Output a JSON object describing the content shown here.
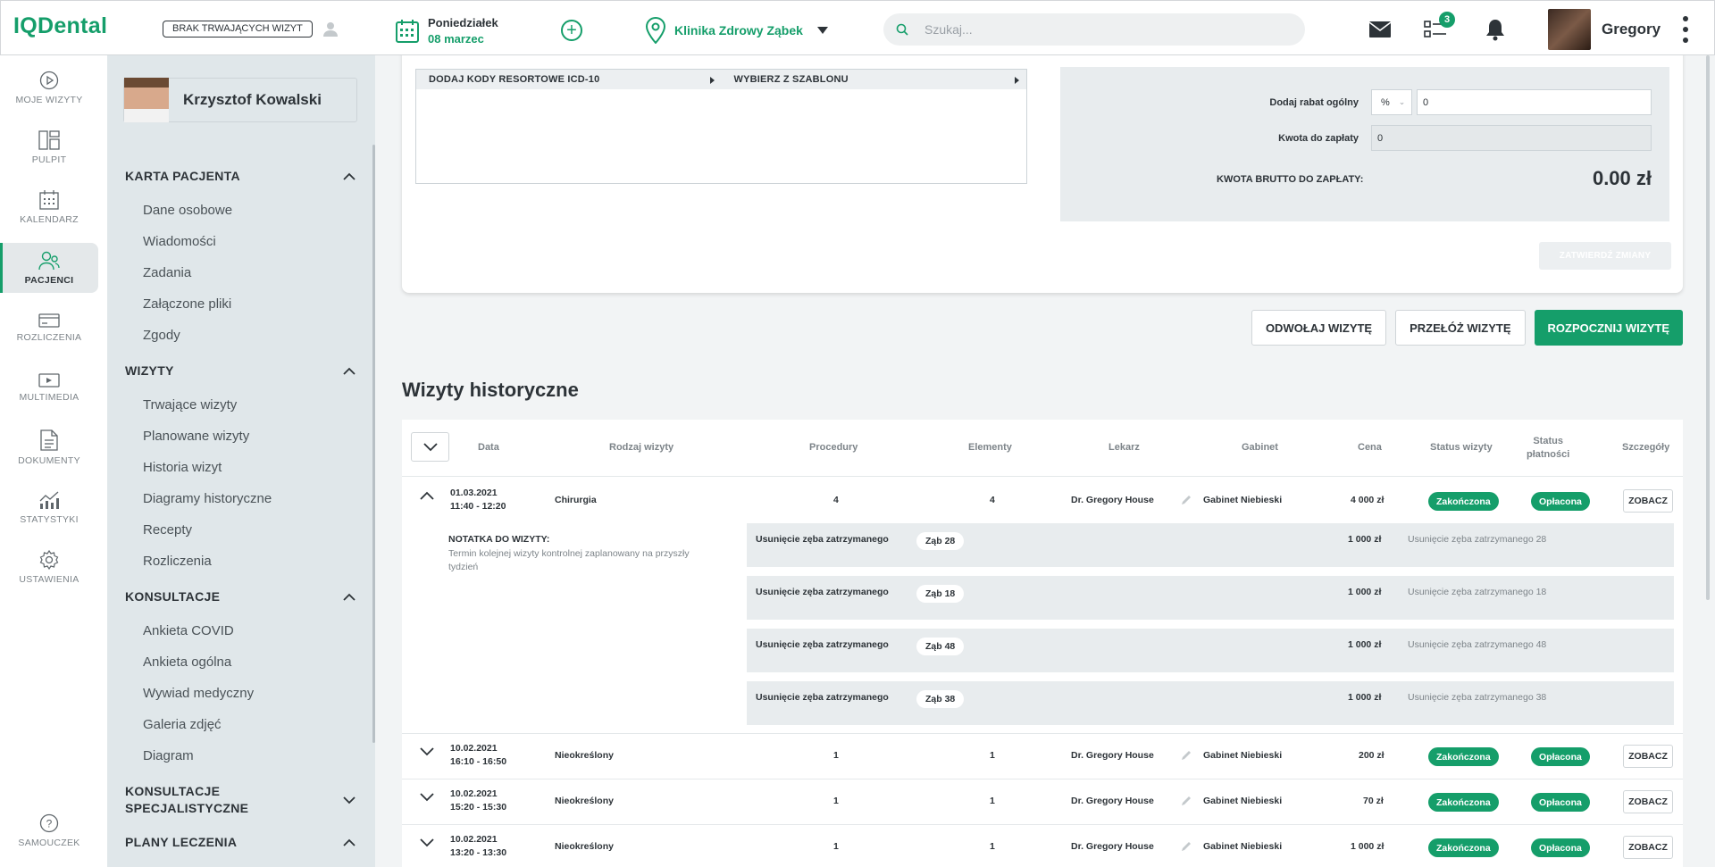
{
  "app": {
    "logo": "IQDental",
    "no_visits_label": "BRAK TRWAJĄCYCH WIZYT"
  },
  "header": {
    "day": "Poniedziałek",
    "date": "08 marzec",
    "clinic": "Klinika Zdrowy Ząbek",
    "search_placeholder": "Szukaj...",
    "tasks_badge": "3",
    "username": "Gregory"
  },
  "nav": [
    {
      "label": "MOJE WIZYTY",
      "icon": "play-circle-icon"
    },
    {
      "label": "PULPIT",
      "icon": "dashboard-icon"
    },
    {
      "label": "KALENDARZ",
      "icon": "calendar-icon"
    },
    {
      "label": "PACJENCI",
      "icon": "patients-icon",
      "active": true
    },
    {
      "label": "ROZLICZENIA",
      "icon": "card-icon"
    },
    {
      "label": "MULTIMEDIA",
      "icon": "media-icon"
    },
    {
      "label": "DOKUMENTY",
      "icon": "document-icon"
    },
    {
      "label": "STATYSTYKI",
      "icon": "stats-icon"
    },
    {
      "label": "USTAWIENIA",
      "icon": "settings-icon"
    },
    {
      "label": "SAMOUCZEK",
      "icon": "help-icon"
    }
  ],
  "patient": {
    "name": "Krzysztof Kowalski",
    "sections": [
      {
        "title": "KARTA PACJENTA",
        "items": [
          "Dane osobowe",
          "Wiadomości",
          "Zadania",
          "Załączone pliki",
          "Zgody"
        ]
      },
      {
        "title": "WIZYTY",
        "items": [
          "Trwające wizyty",
          "Planowane wizyty",
          "Historia wizyt",
          "Diagramy historyczne",
          "Recepty",
          "Rozliczenia"
        ]
      },
      {
        "title": "KONSULTACJE",
        "items": [
          "Ankieta COVID",
          "Ankieta ogólna",
          "Wywiad medyczny",
          "Galeria zdjęć",
          "Diagram"
        ]
      },
      {
        "title_line1": "KONSULTACJE",
        "title_line2": "SPECJALISTYCZNE"
      },
      {
        "title": "PLANY LECZENIA"
      }
    ]
  },
  "icd": {
    "add_codes": "DODAJ KODY RESORTOWE ICD-10",
    "template": "WYBIERZ Z SZABLONU"
  },
  "summary": {
    "discount_label": "Dodaj rabat ogólny",
    "discount_type": "%",
    "discount_value": "0",
    "amount_label": "Kwota do zapłaty",
    "amount_value": "0",
    "gross_label": "KWOTA BRUTTO DO ZAPŁATY:",
    "gross_value": "0.00 zł",
    "confirm": "ZATWIERDŹ ZMIANY"
  },
  "actions": {
    "cancel": "ODWOŁAJ WIZYTĘ",
    "reschedule": "PRZEŁÓŻ WIZYTĘ",
    "start": "ROZPOCZNIJ WIZYTĘ"
  },
  "history": {
    "title": "Wizyty historyczne",
    "columns": {
      "date": "Data",
      "type": "Rodzaj wizyty",
      "procedures": "Procedury",
      "elements": "Elementy",
      "doctor": "Lekarz",
      "office": "Gabinet",
      "price": "Cena",
      "visit_status": "Status wizyty",
      "pay_status_1": "Status",
      "pay_status_2": "płatności",
      "details": "Szczegóły"
    },
    "rows": [
      {
        "date": "01.03.2021",
        "time": "11:40 - 12:20",
        "type": "Chirurgia",
        "procedures": "4",
        "elements": "4",
        "doctor": "Dr. Gregory House",
        "office": "Gabinet Niebieski",
        "price": "4 000 zł",
        "visit_status": "Zakończona",
        "pay_status": "Opłacona",
        "details": "ZOBACZ"
      },
      {
        "date": "10.02.2021",
        "time": "16:10 - 16:50",
        "type": "Nieokreślony",
        "procedures": "1",
        "elements": "1",
        "doctor": "Dr. Gregory House",
        "office": "Gabinet Niebieski",
        "price": "200 zł",
        "visit_status": "Zakończona",
        "pay_status": "Opłacona",
        "details": "ZOBACZ"
      },
      {
        "date": "10.02.2021",
        "time": "15:20 - 15:30",
        "type": "Nieokreślony",
        "procedures": "1",
        "elements": "1",
        "doctor": "Dr. Gregory House",
        "office": "Gabinet Niebieski",
        "price": "70 zł",
        "visit_status": "Zakończona",
        "pay_status": "Opłacona",
        "details": "ZOBACZ"
      },
      {
        "date": "10.02.2021",
        "time": "13:20 - 13:30",
        "type": "Nieokreślony",
        "procedures": "1",
        "elements": "1",
        "doctor": "Dr. Gregory House",
        "office": "Gabinet Niebieski",
        "price": "1 000 zł",
        "visit_status": "Zakończona",
        "pay_status": "Opłacona",
        "details": "ZOBACZ"
      }
    ],
    "note_title": "NOTATKA DO WIZYTY:",
    "note_text": "Termin kolejnej wizyty kontrolnej zaplanowany na przyszły tydzień",
    "procedures": [
      {
        "name": "Usunięcie zęba zatrzymanego",
        "tooth": "Ząb 28",
        "price": "1 000 zł",
        "desc": "Usunięcie zęba zatrzymanego 28"
      },
      {
        "name": "Usunięcie zęba zatrzymanego",
        "tooth": "Ząb 18",
        "price": "1 000 zł",
        "desc": "Usunięcie zęba zatrzymanego 18"
      },
      {
        "name": "Usunięcie zęba zatrzymanego",
        "tooth": "Ząb 48",
        "price": "1 000 zł",
        "desc": "Usunięcie zęba zatrzymanego 48"
      },
      {
        "name": "Usunięcie zęba zatrzymanego",
        "tooth": "Ząb 38",
        "price": "1 000 zł",
        "desc": "Usunięcie zęba zatrzymanego 38"
      }
    ]
  },
  "colors": {
    "accent": "#159e6a",
    "panel": "#e0e7ea",
    "main_bg": "#f2f4f5"
  }
}
